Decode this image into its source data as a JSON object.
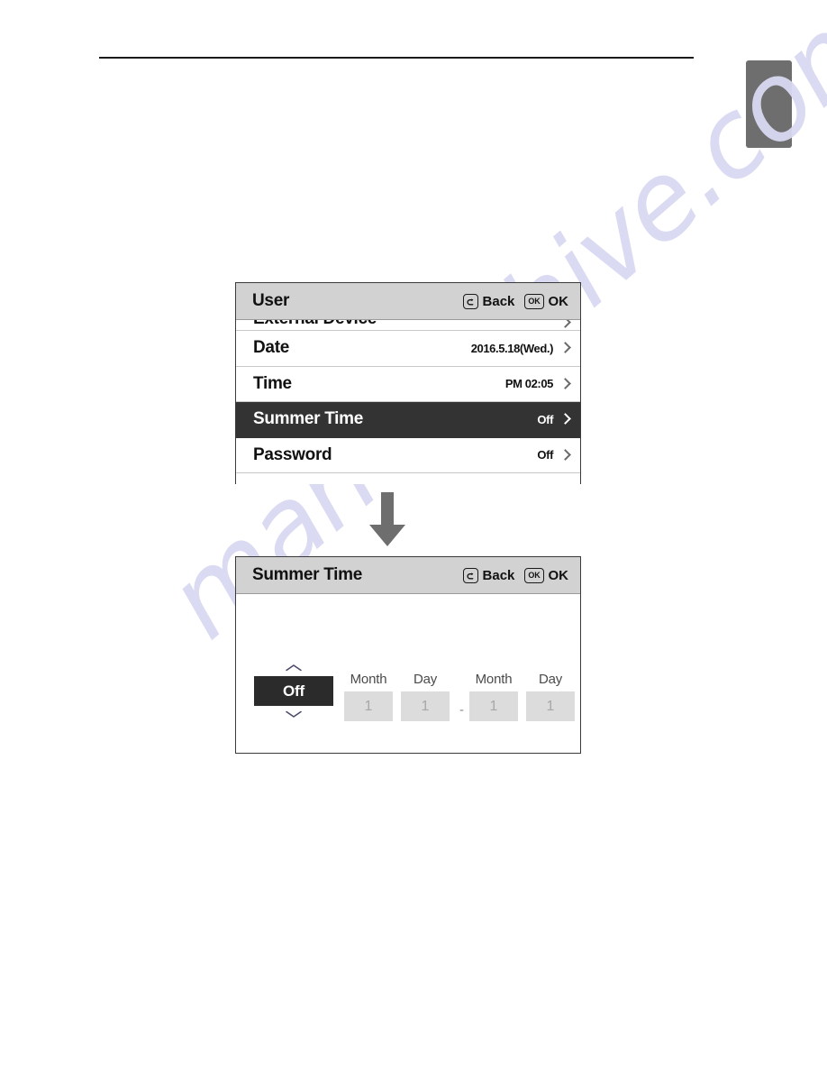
{
  "page": {
    "side_tab": "",
    "watermark": "manualshive.com"
  },
  "user_screen": {
    "title": "User",
    "actions": [
      {
        "icon": "back-arrow-icon",
        "label": "Back"
      },
      {
        "icon": "ok-key-icon",
        "label": "OK",
        "badge": "OK"
      }
    ],
    "rows": [
      {
        "label": "External Device",
        "value": "",
        "selected": false,
        "clipped": true,
        "chevron": "chevron-right-icon"
      },
      {
        "label": "Date",
        "value": "2016.5.18(Wed.)",
        "selected": false,
        "clipped": false,
        "chevron": "chevron-right-icon"
      },
      {
        "label": "Time",
        "value": "PM 02:05",
        "selected": false,
        "clipped": false,
        "chevron": "chevron-right-icon"
      },
      {
        "label": "Summer Time",
        "value": "Off",
        "selected": true,
        "clipped": false,
        "chevron": "chevron-right-icon"
      },
      {
        "label": "Password",
        "value": "Off",
        "selected": false,
        "clipped": false,
        "chevron": "chevron-right-icon"
      }
    ]
  },
  "flow": {
    "arrow": "down-arrow-icon",
    "arrow_color": "#6e6e6e"
  },
  "summer_time_screen": {
    "title": "Summer Time",
    "actions": [
      {
        "icon": "back-arrow-icon",
        "label": "Back"
      },
      {
        "icon": "ok-key-icon",
        "label": "OK",
        "badge": "OK"
      }
    ],
    "toggle": {
      "value": "Off",
      "up_icon": "chevron-up-icon",
      "down_icon": "chevron-down-icon"
    },
    "fields": [
      {
        "label": "Month",
        "value": "1"
      },
      {
        "label": "Day",
        "value": "1"
      },
      {
        "label": "Month",
        "value": "1"
      },
      {
        "label": "Day",
        "value": "1"
      }
    ],
    "range_separator": "-"
  },
  "colors": {
    "header_bg": "#d2d2d2",
    "selected_row_bg": "#333333",
    "toggle_bg": "#2b2b2b",
    "field_bg": "#dcdcdc",
    "arrow_gray": "#6e6e6e",
    "side_tab_gray": "#6e6e6e",
    "watermark": "#d9d9f2"
  }
}
